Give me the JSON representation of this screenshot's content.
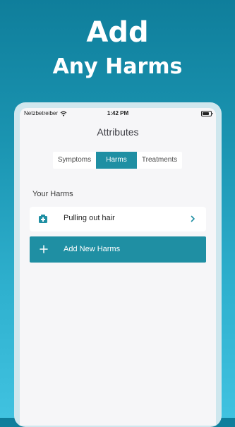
{
  "promo": {
    "line1": "Add",
    "line2": "Any Harms"
  },
  "status_bar": {
    "carrier": "Netzbetreiber",
    "time": "1:42 PM"
  },
  "nav": {
    "title": "Attributes"
  },
  "tabs": [
    {
      "label": "Symptoms",
      "selected": false
    },
    {
      "label": "Harms",
      "selected": true
    },
    {
      "label": "Treatments",
      "selected": false
    }
  ],
  "section": {
    "title": "Your Harms"
  },
  "harms": [
    {
      "label": "Pulling out hair",
      "icon": "harm-icon"
    }
  ],
  "add_button": {
    "label": "Add New Harms",
    "icon": "plus-icon"
  },
  "colors": {
    "accent": "#1f8fa3",
    "background_top": "#0f7e9b",
    "background_bottom": "#40c2e0"
  }
}
